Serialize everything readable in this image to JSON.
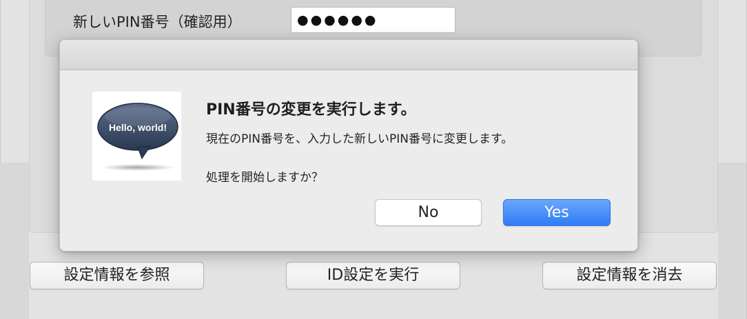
{
  "background_form": {
    "pin_confirm_label": "新しいPIN番号（確認用）",
    "pin_confirm_value": "●●●●●●",
    "buttons": {
      "view_settings": "設定情報を参照",
      "run_id_setup": "ID設定を実行",
      "erase_settings": "設定情報を消去"
    }
  },
  "dialog": {
    "icon": {
      "name": "speech-bubble-icon",
      "text": "Hello, world!"
    },
    "title": "PIN番号の変更を実行します。",
    "message": "現在のPIN番号を、入力した新しいPIN番号に変更します。",
    "question": "処理を開始しますか？",
    "buttons": {
      "no": "No",
      "yes": "Yes"
    }
  },
  "colors": {
    "primary_button": "#3b82f6",
    "dialog_bg": "#ececec",
    "window_bg": "#e3e3e3"
  }
}
